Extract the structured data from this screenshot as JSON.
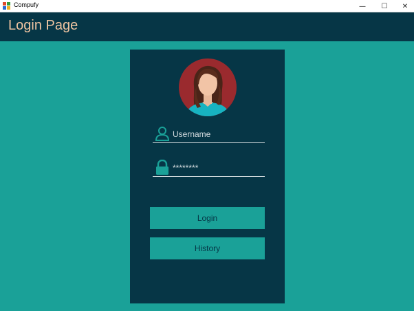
{
  "window": {
    "title": "Compufy",
    "controls": {
      "minimize": "—",
      "maximize": "☐",
      "close": "✕"
    }
  },
  "header": {
    "title": "Login Page"
  },
  "login": {
    "avatar_icon": "woman-avatar-icon",
    "username": {
      "icon": "user-icon",
      "value": "Username"
    },
    "password": {
      "icon": "lock-icon",
      "value": "********"
    },
    "login_button": "Login",
    "history_button": "History"
  },
  "colors": {
    "background": "#1aa198",
    "panel": "#063646",
    "title_text": "#f0c5a2",
    "avatar_bg": "#9a2a2e"
  }
}
